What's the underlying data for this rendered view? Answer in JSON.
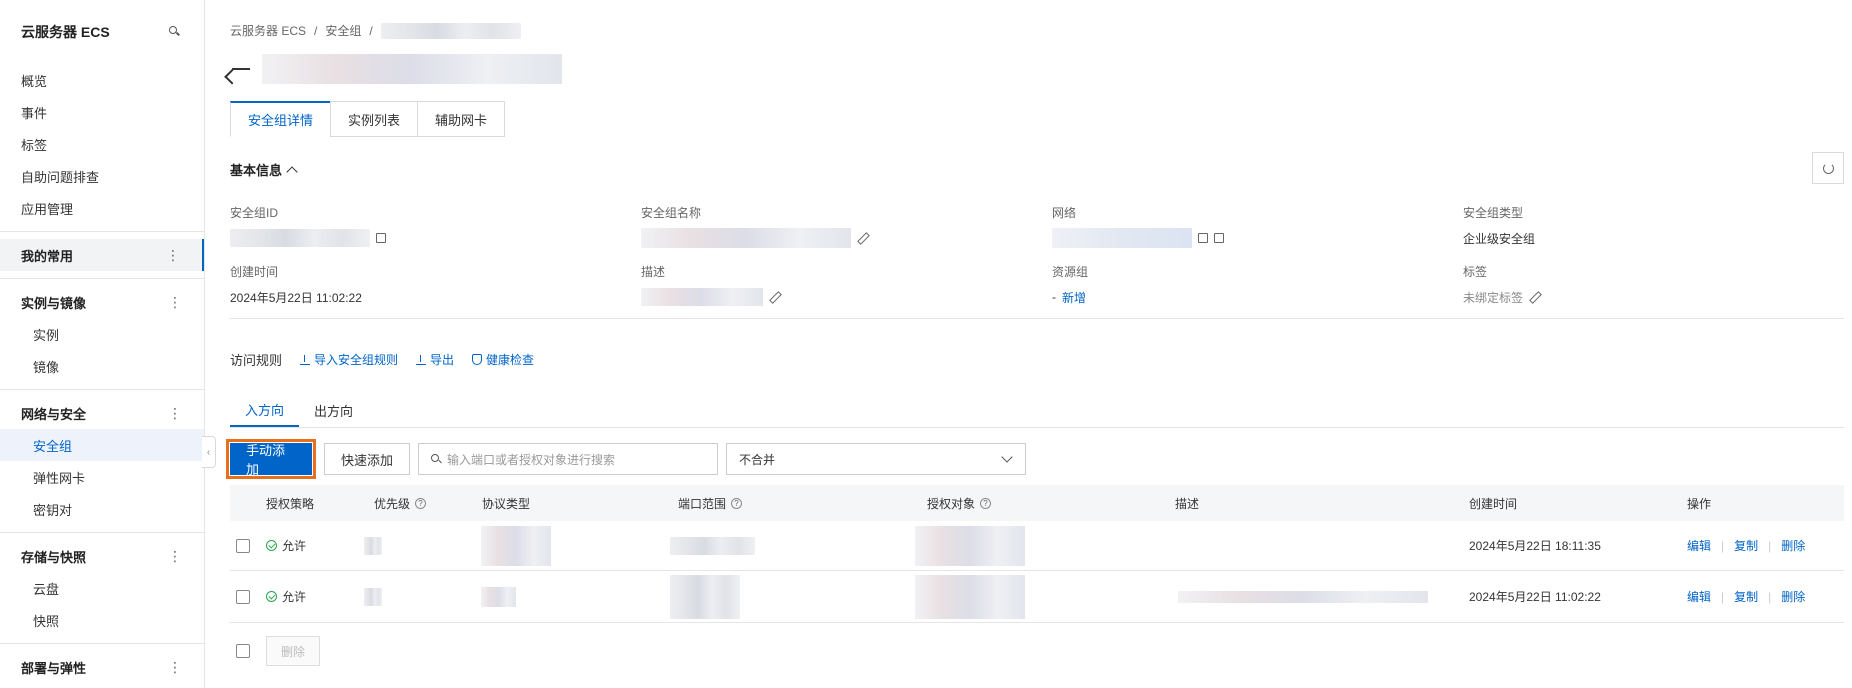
{
  "sidebar": {
    "title": "云服务器 ECS",
    "top_items": [
      "概览",
      "事件",
      "标签",
      "自助问题排查",
      "应用管理"
    ],
    "favorites": "我的常用",
    "groups": [
      {
        "label": "实例与镜像",
        "items": [
          "实例",
          "镜像"
        ]
      },
      {
        "label": "网络与安全",
        "items": [
          "安全组",
          "弹性网卡",
          "密钥对"
        ]
      },
      {
        "label": "存储与快照",
        "items": [
          "云盘",
          "快照"
        ]
      },
      {
        "label": "部署与弹性",
        "items": []
      }
    ],
    "active_item": "安全组"
  },
  "breadcrumb": [
    "云服务器 ECS",
    "/",
    "安全组",
    "/"
  ],
  "tabs": [
    "安全组详情",
    "实例列表",
    "辅助网卡"
  ],
  "basic_info": {
    "title": "基本信息",
    "fields": {
      "sg_id_label": "安全组ID",
      "sg_name_label": "安全组名称",
      "network_label": "网络",
      "sg_type_label": "安全组类型",
      "sg_type_value": "企业级安全组",
      "created_label": "创建时间",
      "created_value": "2024年5月22日 11:02:22",
      "desc_label": "描述",
      "resource_group_label": "资源组",
      "resource_group_dash": "-",
      "resource_group_link": "新增",
      "tags_label": "标签",
      "tags_value": "未绑定标签"
    }
  },
  "rules": {
    "title": "访问规则",
    "links": [
      "导入安全组规则",
      "导出",
      "健康检查"
    ],
    "direction_tabs": [
      "入方向",
      "出方向"
    ],
    "toolbar": {
      "manual_add": "手动添加",
      "quick_add": "快速添加",
      "search_placeholder": "输入端口或者授权对象进行搜索",
      "merge_select": "不合并"
    },
    "columns": [
      "授权策略",
      "优先级",
      "协议类型",
      "端口范围",
      "授权对象",
      "描述",
      "创建时间",
      "操作"
    ],
    "rows": [
      {
        "policy": "允许",
        "created": "2024年5月22日 18:11:35",
        "ops": [
          "编辑",
          "复制",
          "删除"
        ]
      },
      {
        "policy": "允许",
        "created": "2024年5月22日 11:02:22",
        "ops": [
          "编辑",
          "复制",
          "删除"
        ]
      }
    ],
    "delete_button": "删除"
  },
  "colors": {
    "accent": "#0064c8",
    "highlight": "#e8701a",
    "allow": "#2ca24b"
  },
  "icons": [
    "search-icon",
    "back-arrow-icon",
    "chevron-up-icon",
    "refresh-icon",
    "copy-icon",
    "edit-icon",
    "external-link-icon",
    "import-icon",
    "export-icon",
    "shield-icon",
    "help-icon",
    "check-circle-icon",
    "chevron-down-icon"
  ]
}
